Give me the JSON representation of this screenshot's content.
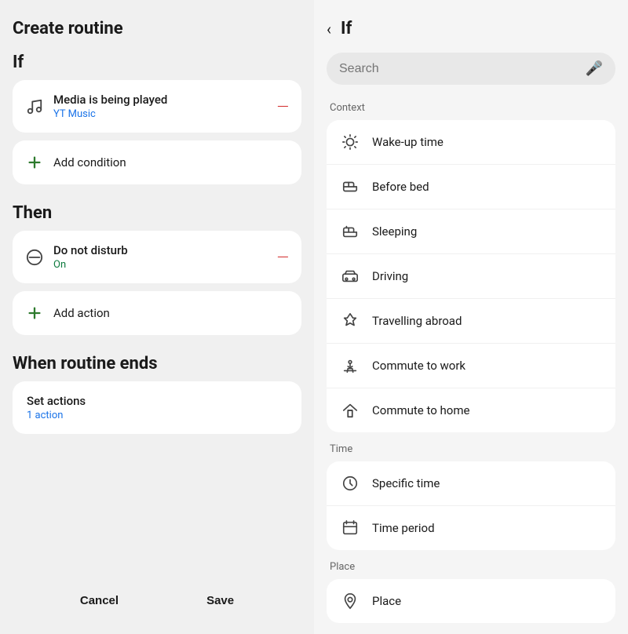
{
  "left": {
    "page_title": "Create routine",
    "if_section": {
      "label": "If",
      "condition": {
        "title": "Media is being played",
        "subtitle": "YT Music"
      },
      "add_condition_label": "Add condition"
    },
    "then_section": {
      "label": "Then",
      "action": {
        "title": "Do not disturb",
        "subtitle": "On"
      },
      "add_action_label": "Add action"
    },
    "when_section": {
      "label": "When routine ends",
      "set_actions": {
        "title": "Set actions",
        "subtitle": "1 action"
      }
    },
    "bottom": {
      "cancel_label": "Cancel",
      "save_label": "Save"
    }
  },
  "right": {
    "back_label": "‹",
    "title": "If",
    "search_placeholder": "Search",
    "context_label": "Context",
    "context_items": [
      {
        "label": "Wake-up time"
      },
      {
        "label": "Before bed"
      },
      {
        "label": "Sleeping"
      },
      {
        "label": "Driving"
      },
      {
        "label": "Travelling abroad"
      },
      {
        "label": "Commute to work"
      },
      {
        "label": "Commute to home"
      }
    ],
    "time_label": "Time",
    "time_items": [
      {
        "label": "Specific time"
      },
      {
        "label": "Time period"
      }
    ],
    "place_label": "Place",
    "place_items": [
      {
        "label": "Place"
      }
    ]
  }
}
